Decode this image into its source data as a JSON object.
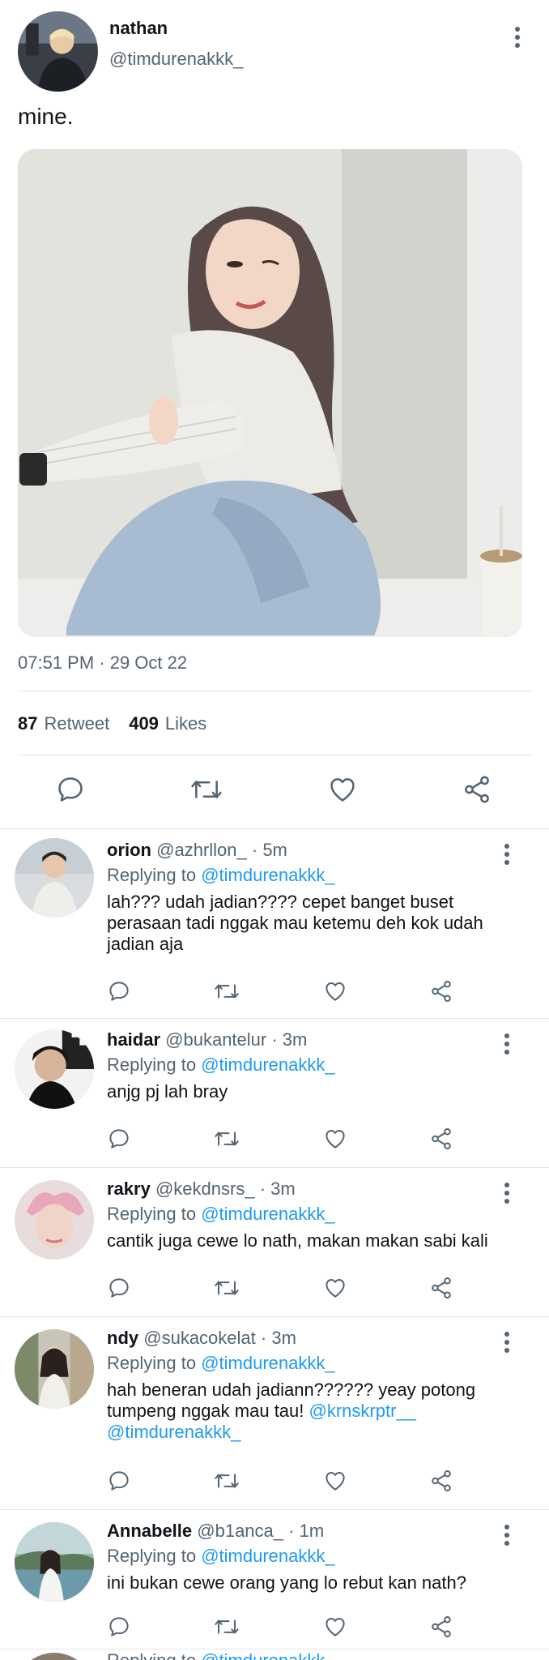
{
  "tweet": {
    "author_name": "nathan",
    "author_handle": "@timdurenakkk_",
    "text": "mine.",
    "timestamp": "07:51 PM · 29 Oct 22",
    "retweet_count": "87",
    "retweet_label": "Retweet",
    "likes_count": "409",
    "likes_label": "Likes"
  },
  "replies": [
    {
      "name": "orion",
      "handle": "@azhrllon_",
      "time": "· 5m",
      "replying_label": "Replying to",
      "replying_to": "@timdurenakkk_",
      "body": "lah??? udah jadian???? cepet banget buset perasaan tadi nggak mau ketemu deh kok udah jadian aja",
      "body_mentions": ""
    },
    {
      "name": "haidar",
      "handle": "@bukantelur",
      "time": "· 3m",
      "replying_label": "Replying to",
      "replying_to": "@timdurenakkk_",
      "body": "anjg pj lah bray",
      "body_mentions": ""
    },
    {
      "name": "rakry",
      "handle": "@kekdnsrs_",
      "time": "· 3m",
      "replying_label": "Replying to",
      "replying_to": "@timdurenakkk_",
      "body": "cantik juga cewe lo nath, makan makan sabi kali",
      "body_mentions": ""
    },
    {
      "name": "ndy",
      "handle": "@sukacokelat",
      "time": "· 3m",
      "replying_label": "Replying to",
      "replying_to": "@timdurenakkk_",
      "body": "hah beneran udah jadiann?????? yeay potong tumpeng nggak mau tau!",
      "body_mentions": "@krnskrptr__ @timdurenakkk_"
    },
    {
      "name": "Annabelle",
      "handle": "@b1anca_",
      "time": "· 1m",
      "replying_label": "Replying to",
      "replying_to": "@timdurenakkk_",
      "body": "ini bukan cewe orang yang lo rebut kan nath?",
      "body_mentions": ""
    }
  ],
  "partial_reply": {
    "replying_label": "Replying to",
    "replying_to": "@timdurenakkk_"
  },
  "icons": [
    "more-icon",
    "reply-icon",
    "retweet-icon",
    "like-icon",
    "share-icon"
  ],
  "colors": {
    "text": "#0f1419",
    "secondary": "#536471",
    "accent": "#1d9bf0",
    "divider": "#e1e5e8"
  }
}
